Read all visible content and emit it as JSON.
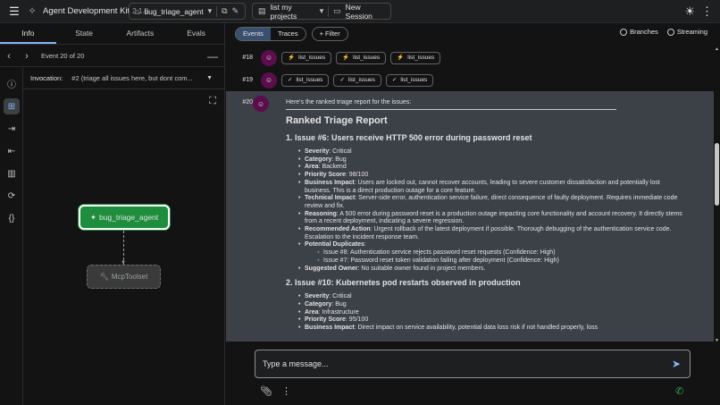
{
  "header": {
    "app_title": "Agent Development Kit",
    "version": "2.1.0",
    "agent_name": "bug_triage_agent",
    "session_label": "list my projects",
    "new_session_label": "New Session"
  },
  "left": {
    "tabs": [
      "Info",
      "State",
      "Artifacts",
      "Evals"
    ],
    "event_label": "Event 20 of 20",
    "invocation_label": "Invocation:",
    "invocation_value": "#2 (triage all issues here, but dont com...",
    "graph": {
      "main_node": "bug_triage_agent",
      "tool_node": "McpToolset"
    }
  },
  "right": {
    "toggle": [
      "Events",
      "Traces"
    ],
    "filter_label": "+ Filter",
    "branches_label": "Branches",
    "streaming_label": "Streaming",
    "rows": [
      {
        "num": "#18",
        "chips": [
          "list_issues",
          "list_issues",
          "list_issues"
        ],
        "chip_icon": "⚡"
      },
      {
        "num": "#19",
        "chips": [
          "list_issues",
          "list_issues",
          "list_issues"
        ],
        "chip_icon": "✓"
      }
    ],
    "event20": {
      "num": "#20",
      "intro": "Here's the ranked triage report for the issues:",
      "title": "Ranked Triage Report",
      "issue1": {
        "heading": "1. Issue #6: Users receive HTTP 500 error during password reset",
        "items": [
          {
            "k": "Severity",
            "v": ": Critical"
          },
          {
            "k": "Category",
            "v": ": Bug"
          },
          {
            "k": "Area",
            "v": ": Backend"
          },
          {
            "k": "Priority Score",
            "v": ": 98/100"
          },
          {
            "k": "Business Impact",
            "v": ": Users are locked out, cannot recover accounts, leading to severe customer dissatisfaction and potentially lost business. This is a direct production outage for a core feature."
          },
          {
            "k": "Technical Impact",
            "v": ": Server-side error, authentication service failure, direct consequence of faulty deployment. Requires immediate code review and fix."
          },
          {
            "k": "Reasoning",
            "v": ": A 500 error during password reset is a production outage impacting core functionality and account recovery. It directly stems from a recent deployment, indicating a severe regression."
          },
          {
            "k": "Recommended Action",
            "v": ": Urgent rollback of the latest deployment if possible. Thorough debugging of the authentication service code. Escalation to the incident response team."
          },
          {
            "k": "Potential Duplicates",
            "v": ":"
          }
        ],
        "duplicates": [
          "Issue #8: Authentication service rejects password reset requests (Confidence: High)",
          "Issue #7: Password reset token validation failing after deployment (Confidence: High)"
        ],
        "owner": {
          "k": "Suggested Owner",
          "v": ": No suitable owner found in project members."
        }
      },
      "issue2": {
        "heading": "2. Issue #10: Kubernetes pod restarts observed in production",
        "items": [
          {
            "k": "Severity",
            "v": ": Critical"
          },
          {
            "k": "Category",
            "v": ": Bug"
          },
          {
            "k": "Area",
            "v": ": Infrastructure"
          },
          {
            "k": "Priority Score",
            "v": ": 95/100"
          },
          {
            "k": "Business Impact",
            "v": ": Direct impact on service availability, potential data loss risk if not handled properly, loss"
          }
        ]
      }
    },
    "input_placeholder": "Type a message..."
  }
}
